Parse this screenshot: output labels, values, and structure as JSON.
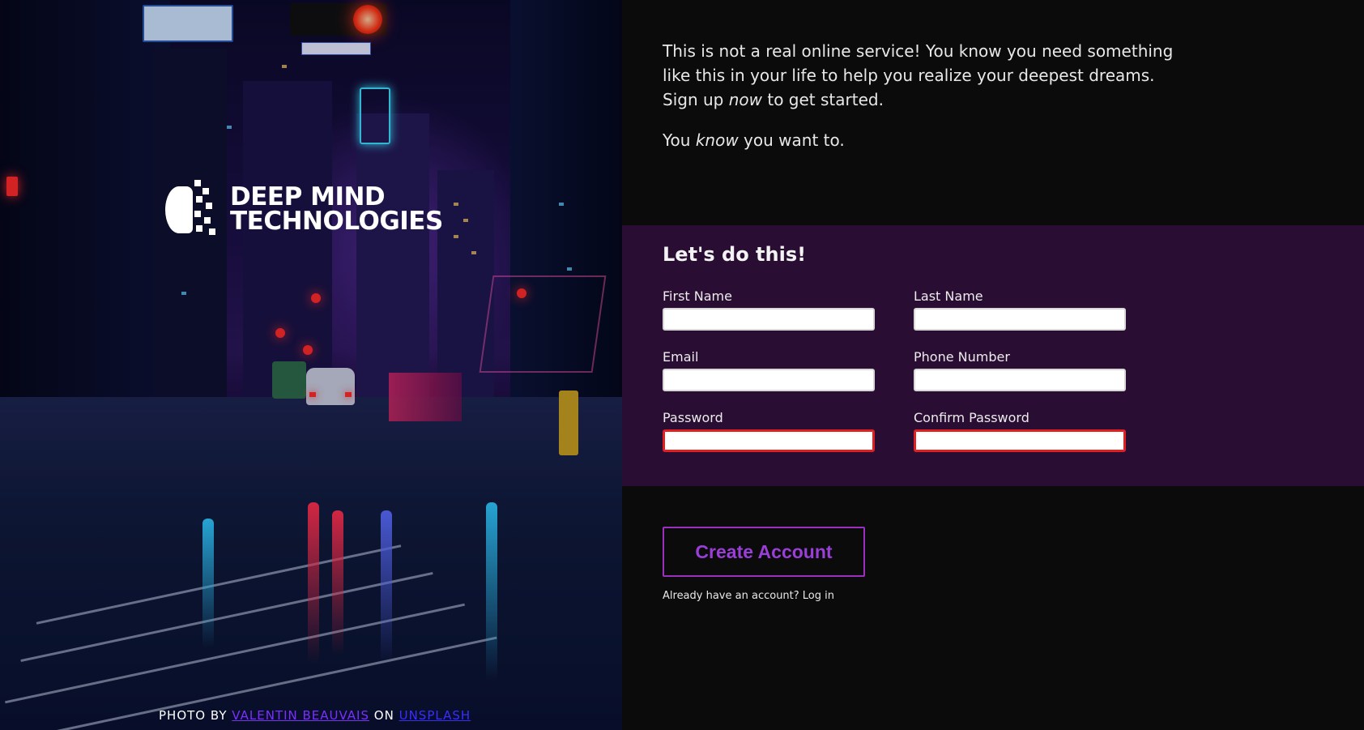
{
  "hero": {
    "logo": {
      "line1": "DEEP MIND",
      "line2": "TECHNOLOGIES"
    },
    "credit": {
      "prefix": "PHOTO BY",
      "author": "VALENTIN BEAUVAIS",
      "middle": "ON",
      "source": "UNSPLASH"
    }
  },
  "intro": {
    "p1_a": "This is not a real online service! You know you need something like this in your life to help you realize your deepest dreams. Sign up ",
    "p1_em": "now",
    "p1_b": " to get started.",
    "p2_a": "You ",
    "p2_em": "know",
    "p2_b": " you want to."
  },
  "form": {
    "title": "Let's do this!",
    "fields": [
      {
        "label": "First Name",
        "value": ""
      },
      {
        "label": "Last Name",
        "value": ""
      },
      {
        "label": "Email",
        "value": ""
      },
      {
        "label": "Phone Number",
        "value": ""
      },
      {
        "label": "Password",
        "value": "",
        "invalid": true
      },
      {
        "label": "Confirm Password",
        "value": "",
        "invalid": true
      }
    ]
  },
  "actions": {
    "create_label": "Create Account",
    "login_text": "Already have an account? ",
    "login_link": "Log in"
  },
  "colors": {
    "accent": "#9a3ed8",
    "form_band": "#2a0d33",
    "background": "#0b0b0b",
    "invalid_border": "#e02020"
  }
}
